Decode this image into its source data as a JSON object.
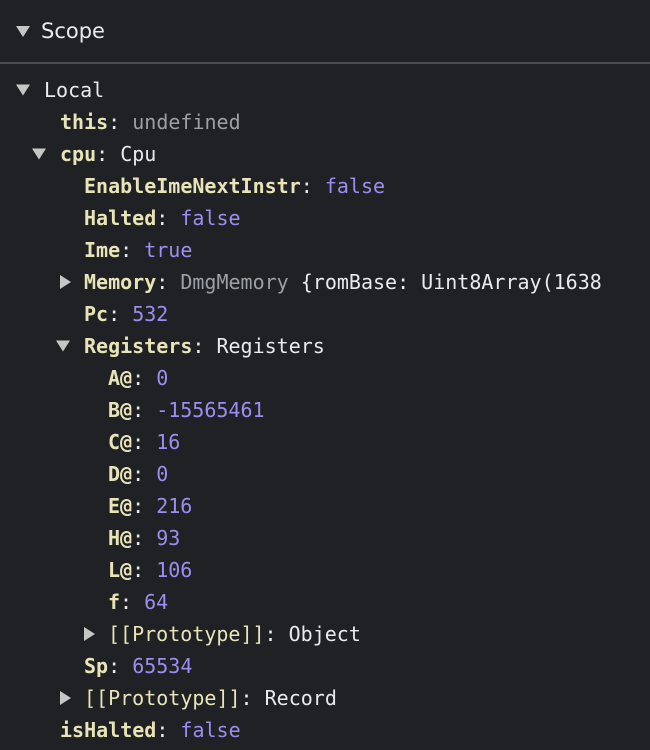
{
  "header": {
    "title": "Scope"
  },
  "tree": {
    "local_label": "Local",
    "this": {
      "key": "this",
      "value": "undefined"
    },
    "cpu": {
      "key": "cpu",
      "type": "Cpu",
      "enable_ime": {
        "key": "EnableImeNextInstr",
        "value": "false"
      },
      "halted": {
        "key": "Halted",
        "value": "false"
      },
      "ime": {
        "key": "Ime",
        "value": "true"
      },
      "memory": {
        "key": "Memory",
        "type": "DmgMemory",
        "preview": "{romBase: Uint8Array(1638"
      },
      "pc": {
        "key": "Pc",
        "value": "532"
      },
      "registers": {
        "key": "Registers",
        "type": "Registers",
        "items": [
          {
            "key": "A@",
            "value": "0"
          },
          {
            "key": "B@",
            "value": "-15565461"
          },
          {
            "key": "C@",
            "value": "16"
          },
          {
            "key": "D@",
            "value": "0"
          },
          {
            "key": "E@",
            "value": "216"
          },
          {
            "key": "H@",
            "value": "93"
          },
          {
            "key": "L@",
            "value": "106"
          },
          {
            "key": "f",
            "value": "64"
          }
        ],
        "prototype": {
          "key": "[[Prototype]]",
          "value": "Object"
        }
      },
      "sp": {
        "key": "Sp",
        "value": "65534"
      },
      "prototype": {
        "key": "[[Prototype]]",
        "value": "Record"
      }
    },
    "is_halted": {
      "key": "isHalted",
      "value": "false"
    }
  }
}
